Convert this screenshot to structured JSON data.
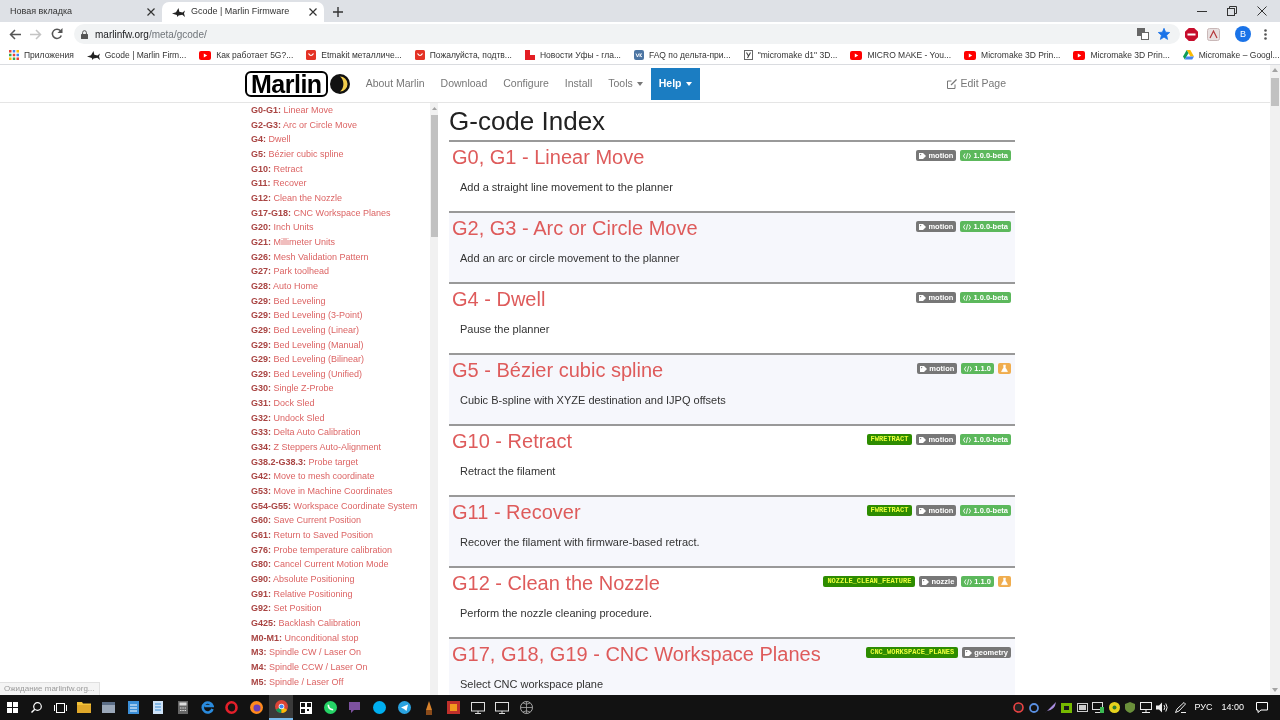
{
  "browser": {
    "tabs": [
      {
        "title": "Новая вкладка",
        "selected": false,
        "favicon": false
      },
      {
        "title": "Gcode | Marlin Firmware",
        "selected": true,
        "favicon": true
      }
    ],
    "toolbar": {
      "forward_disabled": true,
      "host": "marlinfw.org",
      "path": "/meta/gcode/",
      "bookmarked": true,
      "profile_initial": "B"
    },
    "bookmarks": [
      {
        "label": "Приложения",
        "kind": "apps"
      },
      {
        "label": "Gcode | Marlin Firm...",
        "kind": "fish"
      },
      {
        "label": "Как работает 5G?...",
        "kind": "play"
      },
      {
        "label": "Etmakit металличе...",
        "kind": "bag"
      },
      {
        "label": "Пожалуйста, подтв...",
        "kind": "bag"
      },
      {
        "label": "Новости Уфы - гла...",
        "kind": "flag"
      },
      {
        "label": "FAQ по дельта-при...",
        "kind": "square"
      },
      {
        "label": "\"micromake d1\" 3D...",
        "kind": "tile"
      },
      {
        "label": "MICRO MAKE - You...",
        "kind": "play"
      },
      {
        "label": "Micromake 3D Prin...",
        "kind": "play"
      },
      {
        "label": "Micromake 3D Prin...",
        "kind": "play"
      },
      {
        "label": "Micromake – Googl...",
        "kind": "triangle"
      }
    ]
  },
  "site": {
    "logo": "Marlin",
    "nav": [
      {
        "label": "About Marlin",
        "dropdown": false,
        "selected": false
      },
      {
        "label": "Download",
        "dropdown": false,
        "selected": false
      },
      {
        "label": "Configure",
        "dropdown": false,
        "selected": false
      },
      {
        "label": "Install",
        "dropdown": false,
        "selected": false
      },
      {
        "label": "Tools",
        "dropdown": true,
        "selected": false
      },
      {
        "label": "Help",
        "dropdown": true,
        "selected": true
      }
    ],
    "edit_link": "Edit Page"
  },
  "sidebar": {
    "items": [
      {
        "code": "G0-G1:",
        "title": "Linear Move"
      },
      {
        "code": "G2-G3:",
        "title": "Arc or Circle Move"
      },
      {
        "code": "G4:",
        "title": "Dwell"
      },
      {
        "code": "G5:",
        "title": "Bézier cubic spline"
      },
      {
        "code": "G10:",
        "title": "Retract"
      },
      {
        "code": "G11:",
        "title": "Recover"
      },
      {
        "code": "G12:",
        "title": "Clean the Nozzle"
      },
      {
        "code": "G17-G18:",
        "title": "CNC Workspace Planes"
      },
      {
        "code": "G20:",
        "title": "Inch Units"
      },
      {
        "code": "G21:",
        "title": "Millimeter Units"
      },
      {
        "code": "G26:",
        "title": "Mesh Validation Pattern"
      },
      {
        "code": "G27:",
        "title": "Park toolhead"
      },
      {
        "code": "G28:",
        "title": "Auto Home"
      },
      {
        "code": "G29:",
        "title": "Bed Leveling"
      },
      {
        "code": "G29:",
        "title": "Bed Leveling (3-Point)"
      },
      {
        "code": "G29:",
        "title": "Bed Leveling (Linear)"
      },
      {
        "code": "G29:",
        "title": "Bed Leveling (Manual)"
      },
      {
        "code": "G29:",
        "title": "Bed Leveling (Bilinear)"
      },
      {
        "code": "G29:",
        "title": "Bed Leveling (Unified)"
      },
      {
        "code": "G30:",
        "title": "Single Z-Probe"
      },
      {
        "code": "G31:",
        "title": "Dock Sled"
      },
      {
        "code": "G32:",
        "title": "Undock Sled"
      },
      {
        "code": "G33:",
        "title": "Delta Auto Calibration"
      },
      {
        "code": "G34:",
        "title": "Z Steppers Auto-Alignment"
      },
      {
        "code": "G38.2-G38.3:",
        "title": "Probe target"
      },
      {
        "code": "G42:",
        "title": "Move to mesh coordinate"
      },
      {
        "code": "G53:",
        "title": "Move in Machine Coordinates"
      },
      {
        "code": "G54-G55:",
        "title": "Workspace Coordinate System"
      },
      {
        "code": "G60:",
        "title": "Save Current Position"
      },
      {
        "code": "G61:",
        "title": "Return to Saved Position"
      },
      {
        "code": "G76:",
        "title": "Probe temperature calibration"
      },
      {
        "code": "G80:",
        "title": "Cancel Current Motion Mode"
      },
      {
        "code": "G90:",
        "title": "Absolute Positioning"
      },
      {
        "code": "G91:",
        "title": "Relative Positioning"
      },
      {
        "code": "G92:",
        "title": "Set Position"
      },
      {
        "code": "G425:",
        "title": "Backlash Calibration"
      },
      {
        "code": "M0-M1:",
        "title": "Unconditional stop"
      },
      {
        "code": "M3:",
        "title": "Spindle CW / Laser On"
      },
      {
        "code": "M4:",
        "title": "Spindle CCW / Laser On"
      },
      {
        "code": "M5:",
        "title": "Spindle / Laser Off"
      }
    ]
  },
  "index": {
    "heading": "G-code Index",
    "entries": [
      {
        "title": "G0, G1 - Linear Move",
        "description": "Add a straight line movement to the planner",
        "tags": [
          {
            "kind": "tag",
            "label": "motion"
          },
          {
            "kind": "version",
            "label": "1.0.0-beta"
          }
        ]
      },
      {
        "title": "G2, G3 - Arc or Circle Move",
        "description": "Add an arc or circle movement to the planner",
        "tags": [
          {
            "kind": "tag",
            "label": "motion"
          },
          {
            "kind": "version",
            "label": "1.0.0-beta"
          }
        ]
      },
      {
        "title": "G4 - Dwell",
        "description": "Pause the planner",
        "tags": [
          {
            "kind": "tag",
            "label": "motion"
          },
          {
            "kind": "version",
            "label": "1.0.0-beta"
          }
        ]
      },
      {
        "title": "G5 - Bézier cubic spline",
        "description": "Cubic B-spline with XYZE destination and IJPQ offsets",
        "tags": [
          {
            "kind": "tag",
            "label": "motion"
          },
          {
            "kind": "version",
            "label": "1.1.0"
          },
          {
            "kind": "experimental"
          }
        ]
      },
      {
        "title": "G10 - Retract",
        "description": "Retract the filament",
        "tags": [
          {
            "kind": "feature",
            "label": "FWRETRACT"
          },
          {
            "kind": "tag",
            "label": "motion"
          },
          {
            "kind": "version",
            "label": "1.0.0-beta"
          }
        ]
      },
      {
        "title": "G11 - Recover",
        "description": "Recover the filament with firmware-based retract.",
        "tags": [
          {
            "kind": "feature",
            "label": "FWRETRACT"
          },
          {
            "kind": "tag",
            "label": "motion"
          },
          {
            "kind": "version",
            "label": "1.0.0-beta"
          }
        ]
      },
      {
        "title": "G12 - Clean the Nozzle",
        "description": "Perform the nozzle cleaning procedure.",
        "tags": [
          {
            "kind": "feature",
            "label": "NOZZLE_CLEAN_FEATURE"
          },
          {
            "kind": "tag",
            "label": "nozzle"
          },
          {
            "kind": "version",
            "label": "1.1.0"
          },
          {
            "kind": "experimental"
          }
        ]
      },
      {
        "title": "G17, G18, G19 - CNC Workspace Planes",
        "description": "Select CNC workspace plane",
        "tags": [
          {
            "kind": "feature",
            "label": "CNC_WORKSPACE_PLANES"
          },
          {
            "kind": "tag",
            "label": "geometry"
          }
        ]
      }
    ]
  },
  "status_text": "Ожидание marlinfw.org...",
  "taskbar": {
    "apps": [
      {
        "kind": "folder",
        "selected": false
      },
      {
        "kind": "window",
        "selected": false
      },
      {
        "kind": "notepad",
        "selected": false
      },
      {
        "kind": "sheet",
        "selected": false
      },
      {
        "kind": "calculator",
        "selected": false
      },
      {
        "kind": "arc",
        "selected": false
      },
      {
        "kind": "ring",
        "selected": false
      },
      {
        "kind": "flame",
        "selected": false
      },
      {
        "kind": "wheel",
        "selected": true
      },
      {
        "kind": "grid",
        "selected": false
      },
      {
        "kind": "phone",
        "selected": false
      },
      {
        "kind": "chat",
        "selected": false
      },
      {
        "kind": "disc",
        "selected": false
      },
      {
        "kind": "plane",
        "selected": false
      },
      {
        "kind": "pencil",
        "selected": false
      },
      {
        "kind": "tile",
        "selected": false
      },
      {
        "kind": "monitor",
        "selected": false
      },
      {
        "kind": "monitor",
        "selected": false
      },
      {
        "kind": "globe",
        "selected": false
      }
    ],
    "language": "РУС",
    "time": "14:00"
  }
}
